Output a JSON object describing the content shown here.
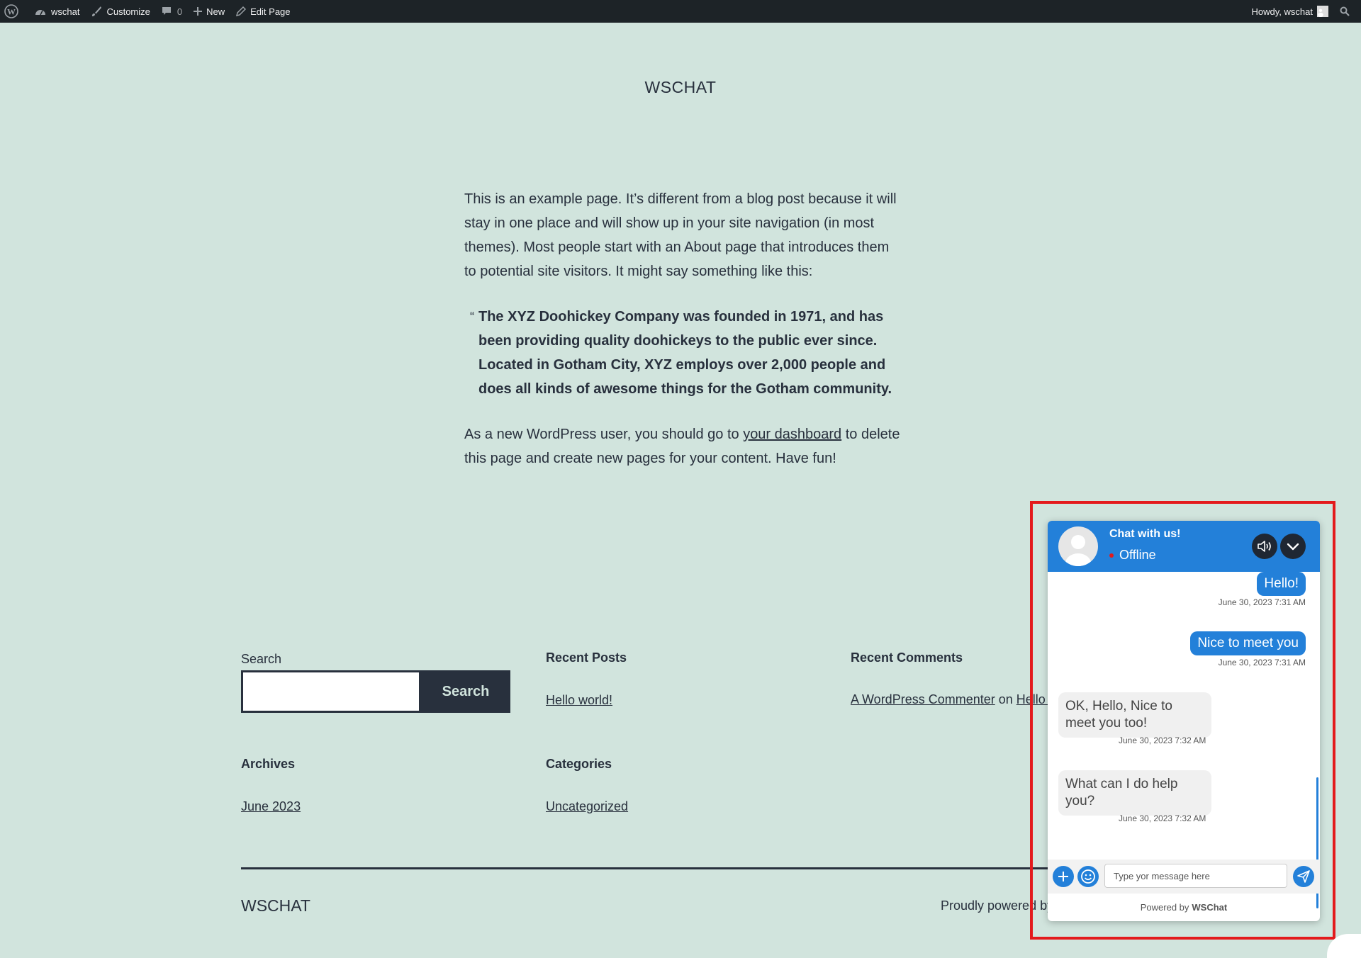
{
  "admin_bar": {
    "site_name": "wschat",
    "customize": "Customize",
    "comments_count": "0",
    "new": "New",
    "edit_page": "Edit Page",
    "howdy": "Howdy, wschat"
  },
  "site_title": "WSCHAT",
  "content": {
    "p1": "This is an example page. It’s different from a blog post because it will stay in one place and will show up in your site navigation (in most themes). Most people start with an About page that introduces them to potential site visitors. It might say something like this:",
    "quote_mark": "“",
    "quote": "The XYZ Doohickey Company was founded in 1971, and has been providing quality doohickeys to the public ever since. Located in Gotham City, XYZ employs over 2,000 people and does all kinds of awesome things for the Gotham community.",
    "p3_before": "As a new WordPress user, you should go to ",
    "p3_link": "your dashboard",
    "p3_after": " to delete this page and create new pages for your content. Have fun!"
  },
  "widgets": {
    "search_label": "Search",
    "search_button": "Search",
    "search_value": "",
    "recent_posts_title": "Recent Posts",
    "recent_post_1": "Hello world!",
    "recent_comments_title": "Recent Comments",
    "comment_author": "A WordPress Commenter",
    "comment_on": " on ",
    "comment_post": "Hello world!",
    "archives_title": "Archives",
    "archive_1": "June 2023",
    "categories_title": "Categories",
    "category_1": "Uncategorized"
  },
  "footer": {
    "title": "WSCHAT",
    "powered": "Proudly powered by WordPress."
  },
  "chat": {
    "title": "Chat with us!",
    "status": "Offline",
    "status_color": "#e31a1c",
    "accent_color": "#2380d9",
    "messages": [
      {
        "text": "Hello!",
        "time": "June 30, 2023 7:31 AM",
        "direction": "out"
      },
      {
        "text": "Nice to meet you",
        "time": "June 30, 2023 7:31 AM",
        "direction": "out"
      },
      {
        "text": "OK, Hello, Nice to meet you too!",
        "time": "June 30, 2023 7:32 AM",
        "direction": "in"
      },
      {
        "text": "What can I do help you?",
        "time": "June 30, 2023 7:32 AM",
        "direction": "in"
      }
    ],
    "input_placeholder": "Type yor message here",
    "input_value": "",
    "powered_prefix": "Powered by",
    "powered_brand": "WSChat"
  },
  "icons": {
    "wp_logo": "wordpress-icon",
    "dashboard": "dashboard-icon",
    "customize": "brush-icon",
    "comments": "comment-icon",
    "new": "plus-icon",
    "edit": "pencil-icon",
    "search": "search-icon",
    "sound": "speaker-icon",
    "collapse": "chevron-down-icon",
    "attach": "plus-circle-icon",
    "emoji": "smiley-icon",
    "send": "send-icon"
  }
}
